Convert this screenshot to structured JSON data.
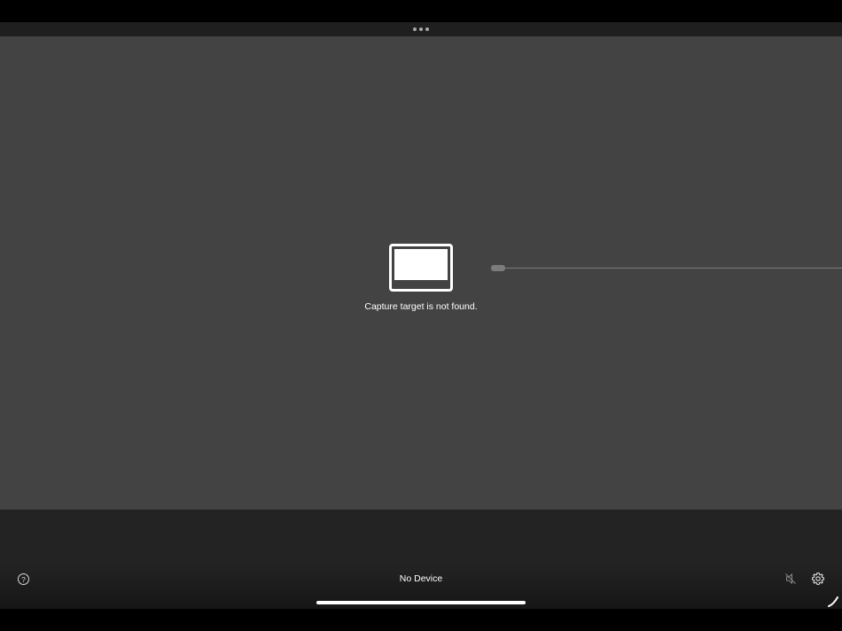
{
  "preview": {
    "message": "Capture target is not found."
  },
  "toolbar": {
    "help_icon": "help-icon",
    "help_glyph": "?",
    "device_label": "No Device",
    "mute_icon": "speaker-muted-icon",
    "settings_icon": "gear-icon"
  },
  "system": {
    "multitask_icon": "ellipsis-icon",
    "home_indicator": "home-indicator",
    "pencil_icon": "pencil-icon"
  },
  "colors": {
    "preview_bg": "#434343",
    "toolbar_bg": "#232323",
    "cable": "#7c7c7c"
  }
}
